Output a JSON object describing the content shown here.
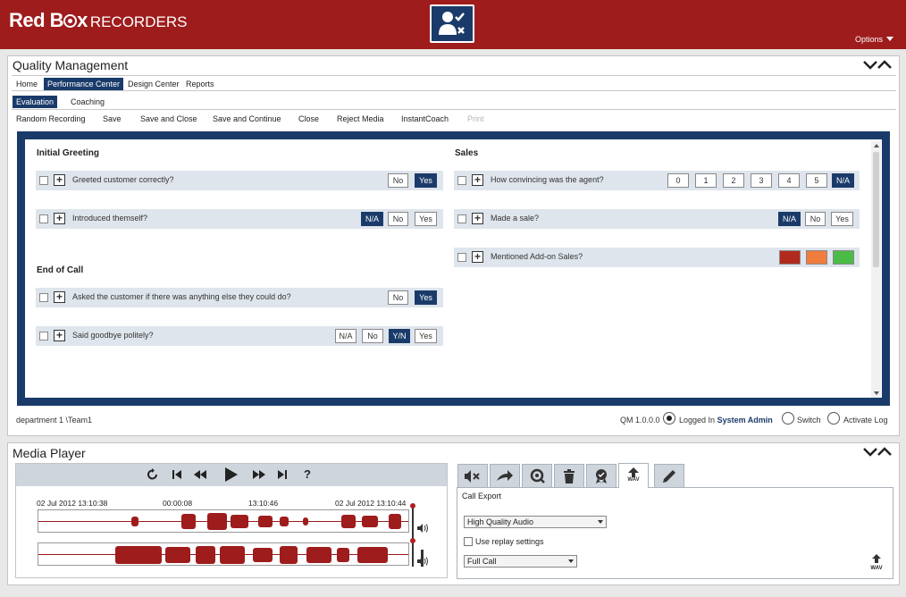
{
  "header": {
    "brand_main": "Red B",
    "brand_tail": "x",
    "brand_sub": "RECORDERS",
    "app_icon": "user-evaluate-icon",
    "options_label": "Options"
  },
  "qm": {
    "title": "Quality Management",
    "nav": [
      "Home",
      "Performance Center",
      "Design Center",
      "Reports"
    ],
    "subnav": [
      "Evaluation",
      "Coaching"
    ],
    "toolbar": [
      "Random Recording",
      "Save",
      "Save and Close",
      "Save and Continue",
      "Close",
      "Reject Media",
      "InstantCoach",
      "Print"
    ],
    "sections": {
      "initial_greeting": "Initial Greeting",
      "end_of_call": "End of Call",
      "sales": "Sales"
    },
    "questions": {
      "q1": {
        "text": "Greeted customer correctly?",
        "answers": [
          "No",
          "Yes"
        ],
        "selected": "Yes"
      },
      "q2": {
        "text": "Introduced themself?",
        "answers": [
          "N/A",
          "No",
          "Yes"
        ],
        "selected": "N/A"
      },
      "q3": {
        "text": "Asked the customer if there was anything else they could do?",
        "answers": [
          "No",
          "Yes"
        ],
        "selected": "Yes"
      },
      "q4": {
        "text": "Said goodbye politely?",
        "answers": [
          "N/A",
          "No",
          "Y/N",
          "Yes"
        ],
        "selected": "Y/N"
      },
      "q5": {
        "text": "How convincing was the agent?",
        "answers": [
          "0",
          "1",
          "2",
          "3",
          "4",
          "5",
          "N/A"
        ],
        "selected": "N/A"
      },
      "q6": {
        "text": "Made a sale?",
        "answers": [
          "N/A",
          "No",
          "Yes"
        ],
        "selected": "N/A"
      },
      "q7": {
        "text": "Mentioned Add-on Sales?",
        "colors": [
          "#b22a1e",
          "#f07c3e",
          "#4bbb48"
        ]
      }
    },
    "status": {
      "path": "department 1 \\Team1",
      "version": "QM 1.0.0.0",
      "logged_in_prefix": "Logged In",
      "logged_in_user": "System Admin",
      "switch_label": "Switch",
      "activate_log_label": "Activate Log"
    }
  },
  "media_player": {
    "title": "Media Player",
    "controls": [
      "replay-icon",
      "skip-start-icon",
      "rewind-icon",
      "play-icon",
      "fast-forward-icon",
      "skip-end-icon",
      "help-icon"
    ],
    "help_label": "?",
    "timestamps": {
      "start": "02 Jul 2012  13:10:38",
      "elapsed": "00:00:08",
      "middle": "13:10:46",
      "end": "02 Jul 2012  13:10:44"
    },
    "tabs": [
      "audio-settings-icon",
      "forward-icon",
      "search-icon",
      "delete-icon",
      "award-icon",
      "wav-export-icon",
      "edit-icon"
    ],
    "wav_label": "WAV",
    "export": {
      "title": "Call Export",
      "quality_value": "High Quality Audio",
      "replay_settings_label": "Use replay settings",
      "range_value": "Full Call",
      "button_label": "WAV"
    }
  },
  "colors": {
    "brand": "#9e1c1c",
    "accent": "#1a3b6a"
  }
}
